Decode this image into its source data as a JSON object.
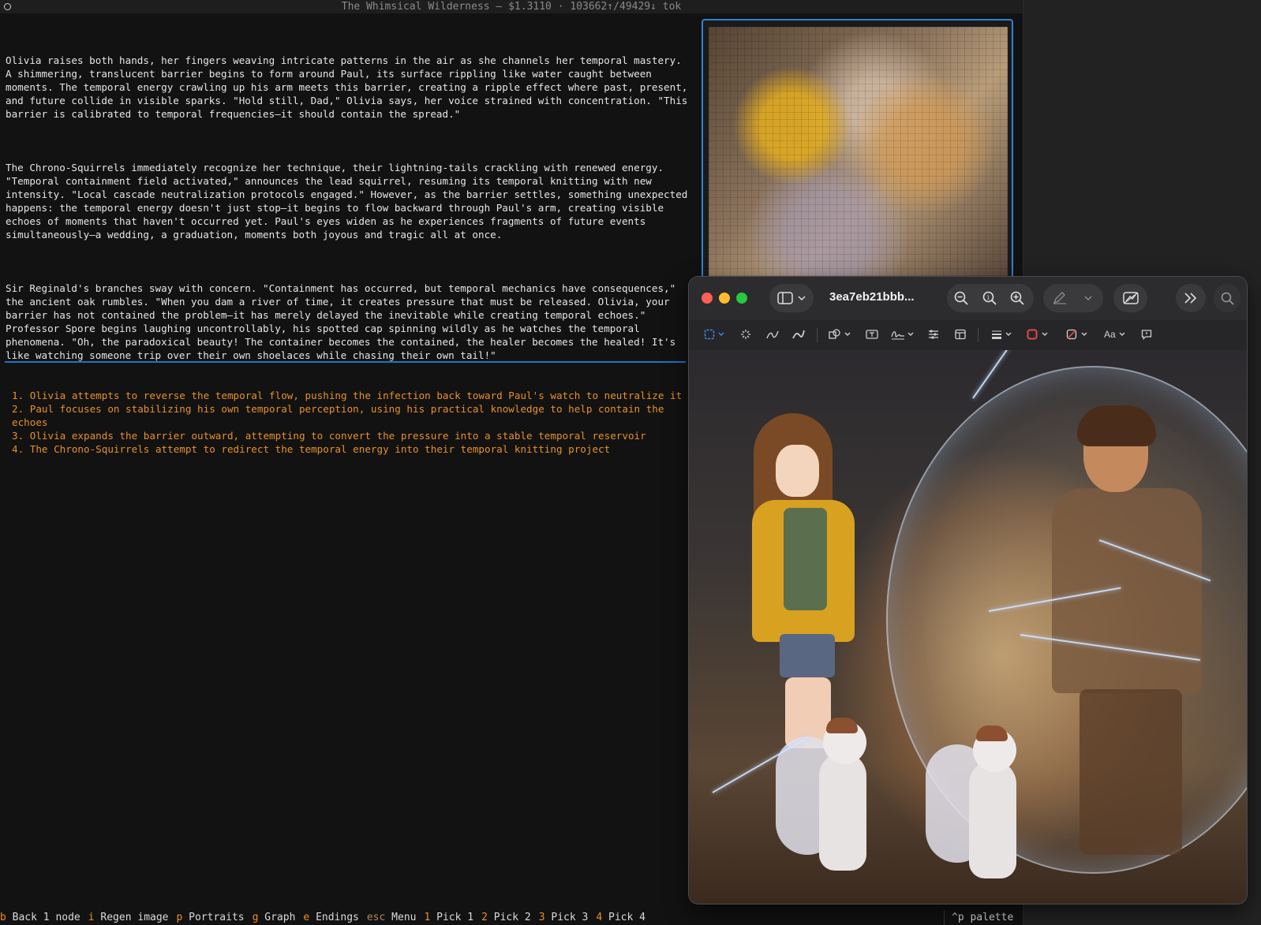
{
  "terminal": {
    "title": "The Whimsical Wilderness — $1.3110  ·  103662↑/49429↓ tok",
    "story": [
      "Olivia raises both hands, her fingers weaving intricate patterns in the air as she channels her temporal mastery. A shimmering, translucent barrier begins to form around Paul, its surface rippling like water caught between moments. The temporal energy crawling up his arm meets this barrier, creating a ripple effect where past, present, and future collide in visible sparks. \"Hold still, Dad,\" Olivia says, her voice strained with concentration. \"This barrier is calibrated to temporal frequencies—it should contain the spread.\"",
      "The Chrono-Squirrels immediately recognize her technique, their lightning-tails crackling with renewed energy. \"Temporal containment field activated,\" announces the lead squirrel, resuming its temporal knitting with new intensity. \"Local cascade neutralization protocols engaged.\" However, as the barrier settles, something unexpected happens: the temporal energy doesn't just stop—it begins to flow backward through Paul's arm, creating visible echoes of moments that haven't occurred yet. Paul's eyes widen as he experiences fragments of future events simultaneously—a wedding, a graduation, moments both joyous and tragic all at once.",
      "Sir Reginald's branches sway with concern. \"Containment has occurred, but temporal mechanics have consequences,\" the ancient oak rumbles. \"When you dam a river of time, it creates pressure that must be released. Olivia, your barrier has not contained the problem—it has merely delayed the inevitable while creating temporal echoes.\" Professor Spore begins laughing uncontrollably, his spotted cap spinning wildly as he watches the temporal phenomena. \"Oh, the paradoxical beauty! The container becomes the contained, the healer becomes the healed! It's like watching someone trip over their own shoelaces while chasing their own tail!\""
    ],
    "choices": [
      "1. Olivia attempts to reverse the temporal flow, pushing the infection back toward Paul's watch to neutralize it",
      "2. Paul focuses on stabilizing his own temporal perception, using his practical knowledge to help contain the echoes",
      "3. Olivia expands the barrier outward, attempting to convert the pressure into a stable temporal reservoir",
      "4. The Chrono-Squirrels attempt to redirect the temporal energy into their temporal knitting project"
    ],
    "status_bar": [
      {
        "key": "b",
        "label": "Back 1 node"
      },
      {
        "key": "i",
        "label": "Regen image"
      },
      {
        "key": "p",
        "label": "Portraits"
      },
      {
        "key": "g",
        "label": "Graph"
      },
      {
        "key": "e",
        "label": "Endings"
      },
      {
        "key": "esc",
        "label": "Menu"
      },
      {
        "key": "1",
        "label": "Pick 1"
      },
      {
        "key": "2",
        "label": "Pick 2"
      },
      {
        "key": "3",
        "label": "Pick 3"
      },
      {
        "key": "4",
        "label": "Pick 4"
      }
    ],
    "palette_hint": "^p palette"
  },
  "preview_window": {
    "title": "3ea7eb21bbb...",
    "toolbar_icons": [
      "sidebar-icon",
      "chevron-down-icon",
      "zoom-out-icon",
      "actual-size-icon",
      "zoom-in-icon",
      "markup-pen-icon",
      "chevron-down-icon",
      "crop-rotate-icon",
      "more-icon",
      "search-icon"
    ],
    "markup_font_label": "Aa",
    "colors": {
      "close": "#ff5f57",
      "minimize": "#febc2e",
      "maximize": "#28c840",
      "accent": "#1f74c4",
      "choice": "#e8902a"
    }
  }
}
